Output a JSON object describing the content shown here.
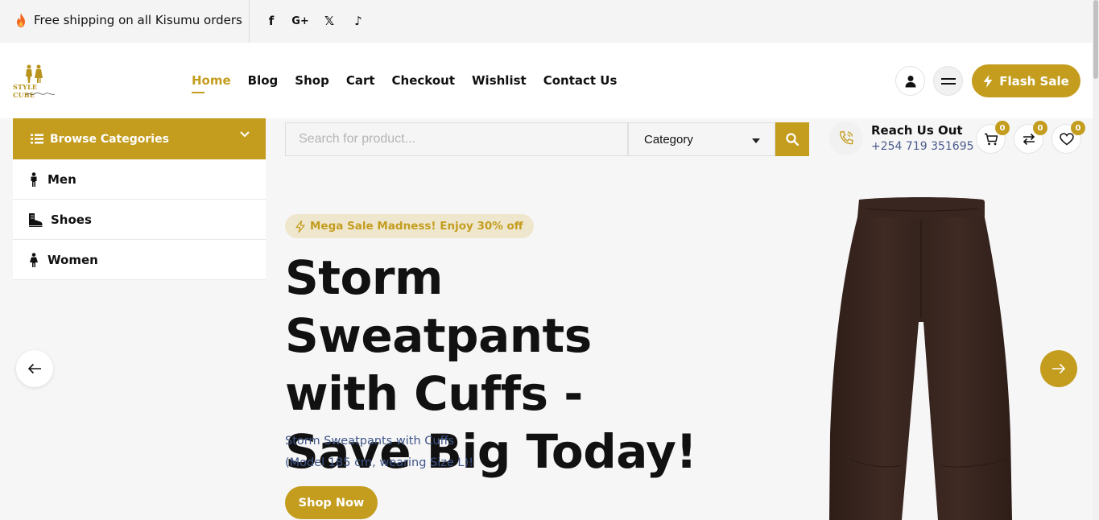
{
  "topbar": {
    "shipping_text": "Free shipping on all Kisumu orders",
    "social": [
      {
        "name": "facebook",
        "glyph": "f"
      },
      {
        "name": "google-plus",
        "glyph": "G+"
      },
      {
        "name": "x",
        "glyph": "𝕏"
      },
      {
        "name": "tiktok",
        "glyph": "♪"
      }
    ]
  },
  "header": {
    "logo_text": "STYLE CUBE",
    "nav": [
      "Home",
      "Blog",
      "Shop",
      "Cart",
      "Checkout",
      "Wishlist",
      "Contact Us"
    ],
    "active_nav": "Home",
    "flash_sale_label": "Flash Sale"
  },
  "sidebar": {
    "browse_label": "Browse Categories",
    "categories": [
      {
        "label": "Men",
        "icon": "man-icon"
      },
      {
        "label": "Shoes",
        "icon": "boot-icon"
      },
      {
        "label": "Women",
        "icon": "woman-icon"
      }
    ]
  },
  "search": {
    "placeholder": "Search for product...",
    "category_selected": "Category"
  },
  "contact": {
    "title": "Reach Us Out",
    "phone": "+254 719 351695"
  },
  "counters": {
    "cart": "0",
    "compare": "0",
    "wishlist": "0"
  },
  "hero": {
    "promo": "Mega Sale Madness! Enjoy 30% off",
    "title": "Storm Sweatpants with Cuffs - Save Big Today!",
    "desc_line1": "Storm Sweatpants with Cuffs",
    "desc_line2": "(Model 185 cm, wearing Size L)!",
    "cta": "Shop Now"
  },
  "colors": {
    "accent": "#c49d1f",
    "promo_bg": "#efe7cd",
    "desc_text": "#3f5589",
    "product": "#3a2620"
  }
}
